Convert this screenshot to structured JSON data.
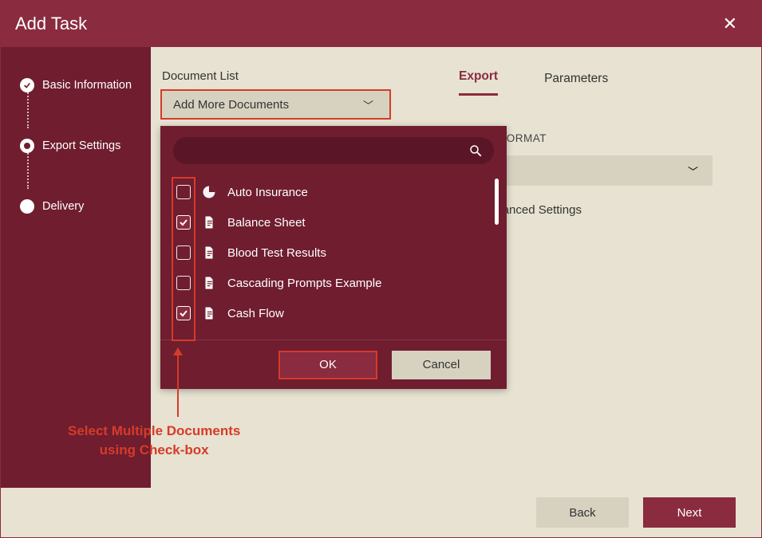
{
  "title": "Add Task",
  "steps": [
    {
      "label": "Basic Information",
      "state": "done"
    },
    {
      "label": "Export Settings",
      "state": "current"
    },
    {
      "label": "Delivery",
      "state": "pending"
    }
  ],
  "document_list": {
    "label": "Document List",
    "dropdown_label": "Add More Documents"
  },
  "search_placeholder": "",
  "documents": [
    {
      "label": "Auto Insurance",
      "icon": "pie",
      "checked": false
    },
    {
      "label": "Balance Sheet",
      "icon": "file",
      "checked": true
    },
    {
      "label": "Blood Test Results",
      "icon": "file",
      "checked": false
    },
    {
      "label": "Cascading Prompts Example",
      "icon": "file",
      "checked": false
    },
    {
      "label": "Cash Flow",
      "icon": "file",
      "checked": true
    }
  ],
  "dropdown_buttons": {
    "ok": "OK",
    "cancel": "Cancel"
  },
  "tabs": {
    "export": "Export",
    "parameters": "Parameters"
  },
  "export_panel": {
    "format_label": "REPORT FORMAT",
    "advanced": "Show Advanced Settings"
  },
  "annotation": {
    "line1": "Select Multiple Documents",
    "line2": "using Check-box"
  },
  "footer": {
    "back": "Back",
    "next": "Next"
  }
}
